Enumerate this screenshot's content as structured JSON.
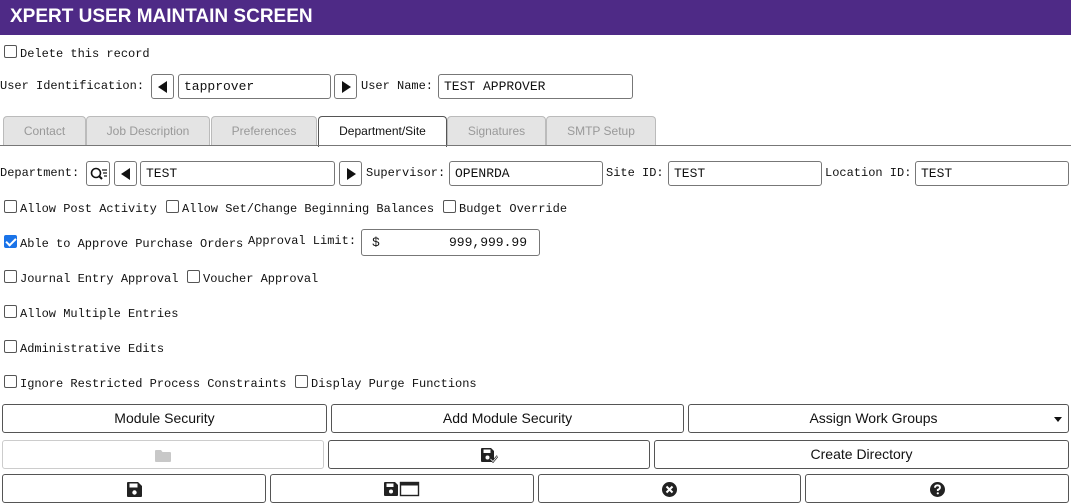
{
  "header": {
    "title": "XPERT USER MAINTAIN SCREEN"
  },
  "delete_record": {
    "label": "Delete this record",
    "checked": false
  },
  "user_id": {
    "label": "User Identification:",
    "value": "tapprover"
  },
  "user_name": {
    "label": "User Name:",
    "value": "TEST APPROVER"
  },
  "tabs": [
    {
      "label": "Contact",
      "active": false
    },
    {
      "label": "Job Description",
      "active": false
    },
    {
      "label": "Preferences",
      "active": false
    },
    {
      "label": "Department/Site",
      "active": true
    },
    {
      "label": "Signatures",
      "active": false
    },
    {
      "label": "SMTP Setup",
      "active": false
    }
  ],
  "department": {
    "label": "Department:",
    "value": "TEST"
  },
  "supervisor": {
    "label": "Supervisor:",
    "value": "OPENRDA"
  },
  "site_id": {
    "label": "Site ID:",
    "value": "TEST"
  },
  "location_id": {
    "label": "Location ID:",
    "value": "TEST"
  },
  "checkboxes": {
    "allow_post_activity": {
      "label": "Allow Post Activity",
      "checked": false
    },
    "allow_set_change_balances": {
      "label": "Allow Set/Change Beginning Balances",
      "checked": false
    },
    "budget_override": {
      "label": "Budget Override",
      "checked": false
    },
    "approve_purchase_orders": {
      "label": "Able to Approve Purchase Orders",
      "checked": true
    },
    "journal_entry_approval": {
      "label": "Journal Entry Approval",
      "checked": false
    },
    "voucher_approval": {
      "label": "Voucher Approval",
      "checked": false
    },
    "allow_multiple_entries": {
      "label": "Allow Multiple Entries",
      "checked": false
    },
    "administrative_edits": {
      "label": "Administrative Edits",
      "checked": false
    },
    "ignore_restricted": {
      "label": "Ignore Restricted Process Constraints",
      "checked": false
    },
    "display_purge": {
      "label": "Display Purge Functions",
      "checked": false
    }
  },
  "approval_limit": {
    "label": "Approval Limit:",
    "currency": "$",
    "value": "999,999.99"
  },
  "buttons": {
    "module_security": "Module Security",
    "add_module_security": "Add Module Security",
    "assign_work_groups": "Assign Work Groups",
    "create_directory": "Create Directory"
  },
  "icons": {
    "folder": "folder-icon",
    "save_check": "save-check-icon",
    "save": "save-icon",
    "save_window": "save-window-icon",
    "cancel": "cancel-icon",
    "help": "help-icon",
    "search": "search-icon"
  },
  "colors": {
    "header_bg": "#4e2a86",
    "checkbox_checked": "#1a73e8"
  }
}
